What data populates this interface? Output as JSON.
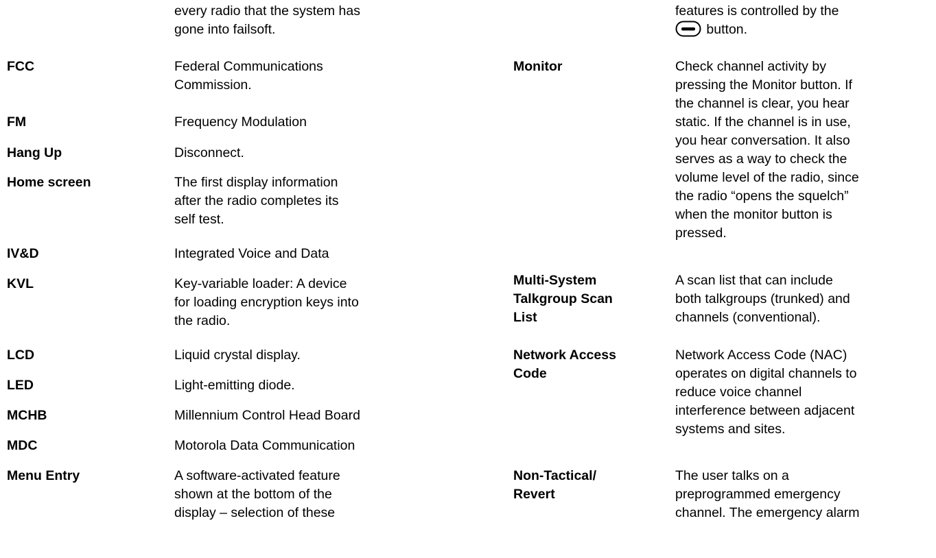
{
  "left_column": [
    {
      "term": "",
      "definition": "every radio that the system has\ngone into failsoft."
    },
    {
      "term": "FCC",
      "definition": "Federal Communications\nCommission."
    },
    {
      "term": "FM",
      "definition": "Frequency Modulation"
    },
    {
      "term": "Hang Up",
      "definition": "Disconnect."
    },
    {
      "term": "Home screen",
      "definition": "The first display information\nafter the radio completes its\nself test."
    },
    {
      "term": "IV&D",
      "definition": "Integrated Voice and Data"
    },
    {
      "term": "KVL",
      "definition": "Key-variable loader: A device\nfor loading encryption keys into\nthe radio."
    },
    {
      "term": "LCD",
      "definition": "Liquid crystal display."
    },
    {
      "term": "LED",
      "definition": "Light-emitting diode."
    },
    {
      "term": "MCHB",
      "definition": "Millennium Control Head Board"
    },
    {
      "term": "MDC",
      "definition": "Motorola Data Communication"
    },
    {
      "term": "Menu Entry",
      "definition": "A software-activated feature\nshown at the bottom of the\ndisplay – selection of these"
    }
  ],
  "right_column": {
    "continuation": {
      "line1": "features is controlled by the",
      "button_icon": "menu-select-button-icon",
      "line2_suffix": " button."
    },
    "entries": [
      {
        "term": "Monitor",
        "definition": "Check channel activity by\npressing the Monitor button. If\nthe channel is clear, you hear\nstatic. If the channel is in use,\nyou hear conversation. It also\nserves as a way to check the\nvolume level of the radio, since\nthe radio “opens the squelch”\nwhen the monitor button is\npressed."
      },
      {
        "term": "Multi-System\nTalkgroup Scan\nList",
        "definition": "A scan list that can include\nboth talkgroups (trunked) and\nchannels (conventional)."
      },
      {
        "term": "Network Access\nCode",
        "definition": "Network Access Code (NAC)\noperates on digital channels to\nreduce voice channel\ninterference between adjacent\nsystems and sites."
      },
      {
        "term": "Non-Tactical/\nRevert",
        "definition": "The user talks on a\npreprogrammed emergency\nchannel. The emergency alarm"
      }
    ]
  }
}
